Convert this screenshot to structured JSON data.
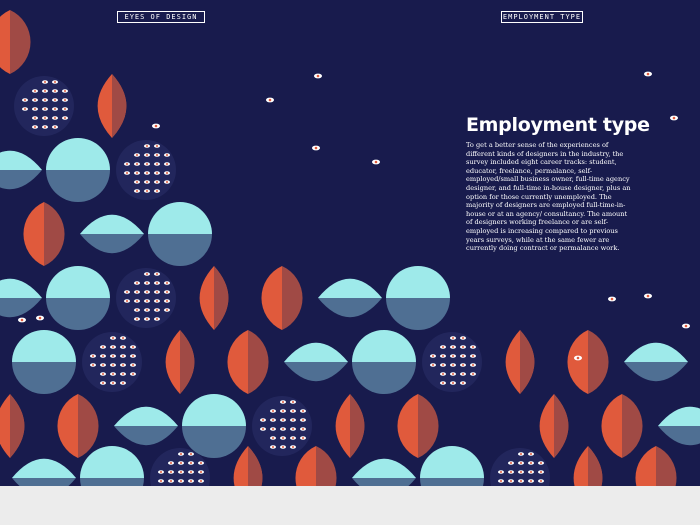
{
  "header": {
    "left_label": "EYES OF DESIGN",
    "right_label": "EMPLOYMENT TYPE"
  },
  "article": {
    "title": "Employment type",
    "body": "To get a better sense of the experiences of different kinds of designers in the industry, the survey included eight career tracks: student, educator, freelance, permalance, self-employed/small business owner, full-time agency designer, and full-time in-house designer, plus an option for those currently unemployed. The majority of designers are employed full-time-in-house or at an agency/ consultancy. The amount of designers working freelance or are self-employed is increasing compared to previous years surveys, while at the same fewer are currently doing contract or permalance work."
  },
  "palette": {
    "background": "#181b4d",
    "orange": "#e05a3c",
    "rust": "#a04a45",
    "cyan": "#9eeaea",
    "slate": "#4f6f93",
    "white": "#ffffff"
  },
  "decoration": {
    "motif": "eye-pattern",
    "icon": "eye-icon"
  }
}
